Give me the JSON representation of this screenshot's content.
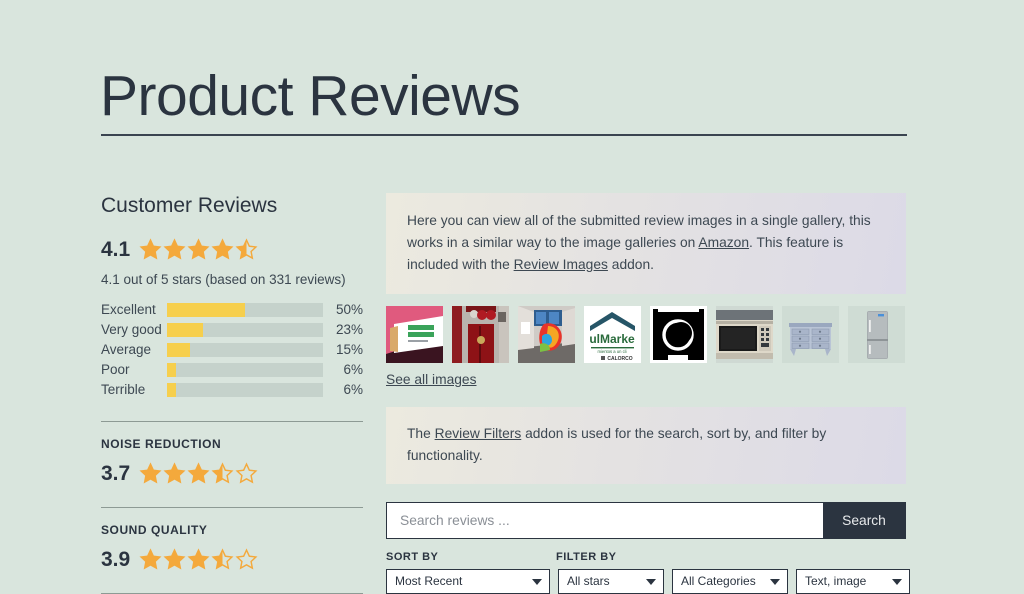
{
  "page": {
    "title": "Product Reviews",
    "background_color": "#d9e5dd",
    "text_color": "#2b3440",
    "star_color": "#f4a93c",
    "bar_fill_color": "#f6cf4d",
    "bar_track_color": "#c5d2cb"
  },
  "reviews_summary": {
    "heading": "Customer Reviews",
    "score": "4.1",
    "stars_filled": 4,
    "stars_half": 1,
    "caption": "4.1 out of 5 stars (based on 331 reviews)",
    "breakdown": [
      {
        "label": "Excellent",
        "percent": "50%",
        "value": 50
      },
      {
        "label": "Very good",
        "percent": "23%",
        "value": 23
      },
      {
        "label": "Average",
        "percent": "15%",
        "value": 15
      },
      {
        "label": "Poor",
        "percent": "6%",
        "value": 6
      },
      {
        "label": "Terrible",
        "percent": "6%",
        "value": 6
      }
    ]
  },
  "sub_ratings": [
    {
      "title": "NOISE REDUCTION",
      "score": "3.7",
      "stars_filled": 3,
      "stars_half": 1,
      "stars_empty": 1
    },
    {
      "title": "SOUND QUALITY",
      "score": "3.9",
      "stars_filled": 3,
      "stars_half": 1,
      "stars_empty": 1
    }
  ],
  "gallery_notice": {
    "text_1": "Here you can view all of the submitted review images in a single gallery, this works in a similar way to the image galleries on ",
    "link_1": "Amazon",
    "text_2": ". This feature is included with the ",
    "link_2": "Review Images",
    "text_3": " addon."
  },
  "gallery": {
    "see_all_label": "See all images",
    "thumbnails": [
      {
        "name": "good-vibes-card-thumbnail"
      },
      {
        "name": "red-door-hallway-thumbnail"
      },
      {
        "name": "colorful-sculpture-thumbnail"
      },
      {
        "name": "ulmarket-logo-thumbnail"
      },
      {
        "name": "washing-machine-thumbnail"
      },
      {
        "name": "microwave-oven-thumbnail"
      },
      {
        "name": "blue-dresser-thumbnail"
      },
      {
        "name": "refrigerator-thumbnail"
      }
    ]
  },
  "filters_notice": {
    "text_1": "The ",
    "link_1": "Review Filters",
    "text_2": " addon is used for the search, sort by, and filter by functionality."
  },
  "search": {
    "placeholder": "Search reviews ...",
    "button_label": "Search"
  },
  "filters": {
    "sort_by_label": "SORT BY",
    "filter_by_label": "FILTER BY",
    "sort_value": "Most Recent",
    "stars_value": "All stars",
    "categories_value": "All Categories",
    "type_value": "Text, image"
  }
}
